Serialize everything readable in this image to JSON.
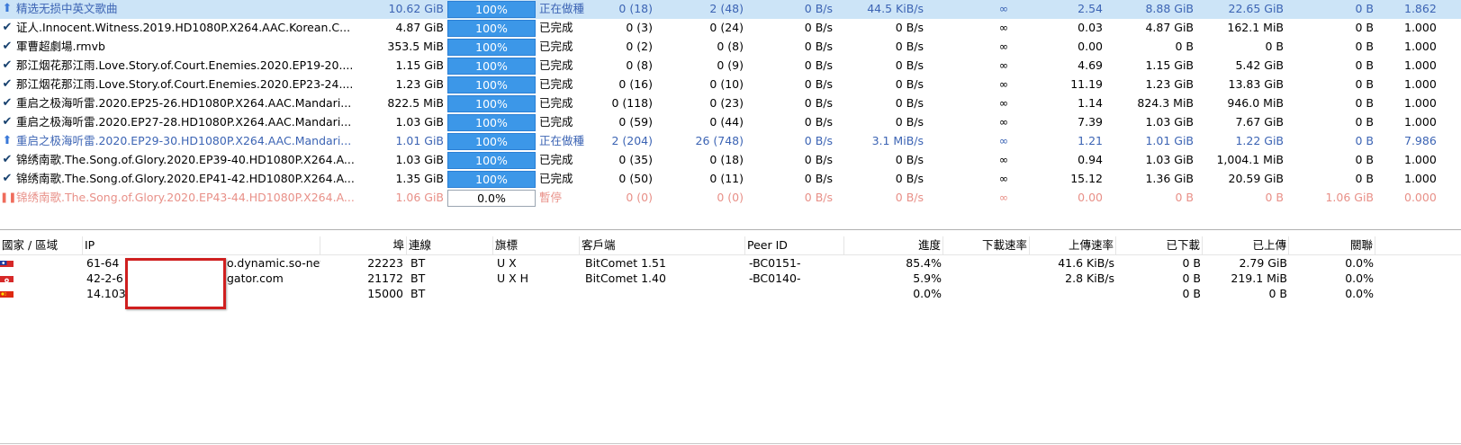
{
  "torrents": [
    {
      "icon": "arrow-up-icon",
      "name": "精选无损中英文歌曲",
      "size": "10.62 GiB",
      "progress": "100%",
      "progress_fraction": 1.0,
      "status": "正在做種",
      "seeds": "0 (18)",
      "peers": "2 (48)",
      "down_speed": "0 B/s",
      "up_speed": "44.5 KiB/s",
      "eta": "∞",
      "ratio": "2.54",
      "downloaded": "8.88 GiB",
      "uploaded": "22.65 GiB",
      "left": "0 B",
      "availability": "1.862",
      "state": "seeding",
      "selected": true
    },
    {
      "icon": "checkmark-icon",
      "name": "证人.Innocent.Witness.2019.HD1080P.X264.AAC.Korean.C...",
      "size": "4.87 GiB",
      "progress": "100%",
      "progress_fraction": 1.0,
      "status": "已完成",
      "seeds": "0 (3)",
      "peers": "0 (24)",
      "down_speed": "0 B/s",
      "up_speed": "0 B/s",
      "eta": "∞",
      "ratio": "0.03",
      "downloaded": "4.87 GiB",
      "uploaded": "162.1 MiB",
      "left": "0 B",
      "availability": "1.000",
      "state": "done"
    },
    {
      "icon": "checkmark-icon",
      "name": "軍曹超劇場.rmvb",
      "size": "353.5 MiB",
      "progress": "100%",
      "progress_fraction": 1.0,
      "status": "已完成",
      "seeds": "0 (2)",
      "peers": "0 (8)",
      "down_speed": "0 B/s",
      "up_speed": "0 B/s",
      "eta": "∞",
      "ratio": "0.00",
      "downloaded": "0 B",
      "uploaded": "0 B",
      "left": "0 B",
      "availability": "1.000",
      "state": "done"
    },
    {
      "icon": "checkmark-icon",
      "name": "那江烟花那江雨.Love.Story.of.Court.Enemies.2020.EP19-20....",
      "size": "1.15 GiB",
      "progress": "100%",
      "progress_fraction": 1.0,
      "status": "已完成",
      "seeds": "0 (8)",
      "peers": "0 (9)",
      "down_speed": "0 B/s",
      "up_speed": "0 B/s",
      "eta": "∞",
      "ratio": "4.69",
      "downloaded": "1.15 GiB",
      "uploaded": "5.42 GiB",
      "left": "0 B",
      "availability": "1.000",
      "state": "done"
    },
    {
      "icon": "checkmark-icon",
      "name": "那江烟花那江雨.Love.Story.of.Court.Enemies.2020.EP23-24....",
      "size": "1.23 GiB",
      "progress": "100%",
      "progress_fraction": 1.0,
      "status": "已完成",
      "seeds": "0 (16)",
      "peers": "0 (10)",
      "down_speed": "0 B/s",
      "up_speed": "0 B/s",
      "eta": "∞",
      "ratio": "11.19",
      "downloaded": "1.23 GiB",
      "uploaded": "13.83 GiB",
      "left": "0 B",
      "availability": "1.000",
      "state": "done"
    },
    {
      "icon": "checkmark-icon",
      "name": "重启之极海听雷.2020.EP25-26.HD1080P.X264.AAC.Mandari...",
      "size": "822.5 MiB",
      "progress": "100%",
      "progress_fraction": 1.0,
      "status": "已完成",
      "seeds": "0 (118)",
      "peers": "0 (23)",
      "down_speed": "0 B/s",
      "up_speed": "0 B/s",
      "eta": "∞",
      "ratio": "1.14",
      "downloaded": "824.3 MiB",
      "uploaded": "946.0 MiB",
      "left": "0 B",
      "availability": "1.000",
      "state": "done"
    },
    {
      "icon": "checkmark-icon",
      "name": "重启之极海听雷.2020.EP27-28.HD1080P.X264.AAC.Mandari...",
      "size": "1.03 GiB",
      "progress": "100%",
      "progress_fraction": 1.0,
      "status": "已完成",
      "seeds": "0 (59)",
      "peers": "0 (44)",
      "down_speed": "0 B/s",
      "up_speed": "0 B/s",
      "eta": "∞",
      "ratio": "7.39",
      "downloaded": "1.03 GiB",
      "uploaded": "7.67 GiB",
      "left": "0 B",
      "availability": "1.000",
      "state": "done"
    },
    {
      "icon": "arrow-up-icon",
      "name": "重启之极海听雷.2020.EP29-30.HD1080P.X264.AAC.Mandari...",
      "size": "1.01 GiB",
      "progress": "100%",
      "progress_fraction": 1.0,
      "status": "正在做種",
      "seeds": "2 (204)",
      "peers": "26 (748)",
      "down_speed": "0 B/s",
      "up_speed": "3.1 MiB/s",
      "eta": "∞",
      "ratio": "1.21",
      "downloaded": "1.01 GiB",
      "uploaded": "1.22 GiB",
      "left": "0 B",
      "availability": "7.986",
      "state": "seeding"
    },
    {
      "icon": "checkmark-icon",
      "name": "锦绣南歌.The.Song.of.Glory.2020.EP39-40.HD1080P.X264.A...",
      "size": "1.03 GiB",
      "progress": "100%",
      "progress_fraction": 1.0,
      "status": "已完成",
      "seeds": "0 (35)",
      "peers": "0 (18)",
      "down_speed": "0 B/s",
      "up_speed": "0 B/s",
      "eta": "∞",
      "ratio": "0.94",
      "downloaded": "1.03 GiB",
      "uploaded": "1,004.1 MiB",
      "left": "0 B",
      "availability": "1.000",
      "state": "done"
    },
    {
      "icon": "checkmark-icon",
      "name": "锦绣南歌.The.Song.of.Glory.2020.EP41-42.HD1080P.X264.A...",
      "size": "1.35 GiB",
      "progress": "100%",
      "progress_fraction": 1.0,
      "status": "已完成",
      "seeds": "0 (50)",
      "peers": "0 (11)",
      "down_speed": "0 B/s",
      "up_speed": "0 B/s",
      "eta": "∞",
      "ratio": "15.12",
      "downloaded": "1.36 GiB",
      "uploaded": "20.59 GiB",
      "left": "0 B",
      "availability": "1.000",
      "state": "done"
    },
    {
      "icon": "pause-icon",
      "name": "锦绣南歌.The.Song.of.Glory.2020.EP43-44.HD1080P.X264.A...",
      "size": "1.06 GiB",
      "progress": "0.0%",
      "progress_fraction": 0.0,
      "status": "暫停",
      "seeds": "0 (0)",
      "peers": "0 (0)",
      "down_speed": "0 B/s",
      "up_speed": "0 B/s",
      "eta": "∞",
      "ratio": "0.00",
      "downloaded": "0 B",
      "uploaded": "0 B",
      "left": "1.06 GiB",
      "availability": "0.000",
      "state": "paused"
    }
  ],
  "peer_headers": {
    "country": "國家 / 區域",
    "ip": "IP",
    "port": "埠",
    "connection": "連線",
    "flags": "旗標",
    "client": "客戶端",
    "peer_id": "Peer ID",
    "progress": "進度",
    "down_speed": "下載速率",
    "up_speed": "上傳速率",
    "downloaded": "已下載",
    "uploaded": "已上傳",
    "relevance": "關聯"
  },
  "peers": [
    {
      "flag": "taiwan-flag-icon",
      "ip": "61-64",
      "host": "o.dynamic.so-net...",
      "port": "22223",
      "connection": "BT",
      "flags": "U X",
      "client": "BitComet 1.51",
      "peer_id": "-BC0151-",
      "progress": "85.4%",
      "down_speed": "",
      "up_speed": "41.6 KiB/s",
      "downloaded": "0 B",
      "uploaded": "2.79 GiB",
      "relevance": "0.0%"
    },
    {
      "flag": "hong-kong-flag-icon",
      "ip": "42-2-6",
      "host": "gator.com",
      "port": "21172",
      "connection": "BT",
      "flags": "U X H",
      "client": "BitComet 1.40",
      "peer_id": "-BC0140-",
      "progress": "5.9%",
      "down_speed": "",
      "up_speed": "2.8 KiB/s",
      "downloaded": "0 B",
      "uploaded": "219.1 MiB",
      "relevance": "0.0%"
    },
    {
      "flag": "china-flag-icon",
      "ip": "14.103",
      "host": "",
      "port": "15000",
      "connection": "BT",
      "flags": "",
      "client": "",
      "peer_id": "",
      "progress": "0.0%",
      "down_speed": "",
      "up_speed": "",
      "downloaded": "0 B",
      "uploaded": "0 B",
      "relevance": "0.0%"
    }
  ],
  "colors": {
    "selected_row": "#cce4f7",
    "progress_fill": "#3c97e8",
    "seeding_text": "#3c64b4",
    "paused_text": "#e89088",
    "redaction_border": "#cf1f1f"
  }
}
